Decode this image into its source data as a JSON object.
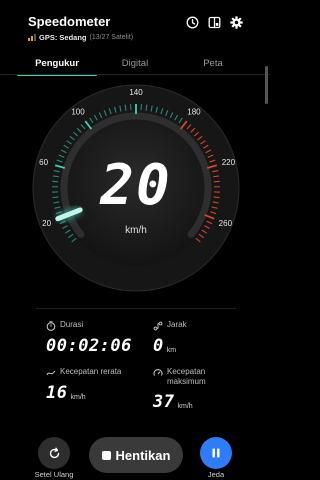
{
  "app": {
    "title": "Speedometer",
    "gps_label": "GPS: Sedang",
    "gps_detail": "(13/27 Satelit)"
  },
  "header_icons": [
    "history-icon",
    "split-screen-icon",
    "settings-gear-icon"
  ],
  "tabs": [
    {
      "label": "Pengukur",
      "active": true
    },
    {
      "label": "Digital",
      "active": false
    },
    {
      "label": "Peta",
      "active": false
    }
  ],
  "gauge": {
    "speed": "20",
    "unit": "km/h",
    "max_speed": 280,
    "tick_labels": [
      "20",
      "60",
      "100",
      "140",
      "180",
      "220",
      "260"
    ],
    "accent_color": "#3fd2b8",
    "warning_color": "#e04a2a"
  },
  "stats": {
    "duration": {
      "label": "Durasi",
      "value": "00:02:06"
    },
    "distance": {
      "label": "Jarak",
      "value": "0",
      "unit": "km"
    },
    "avg_speed": {
      "label": "Kecepatan rerata",
      "value": "16",
      "unit": "km/h"
    },
    "max_speed": {
      "label": "Kecepatan maksimum",
      "value": "37",
      "unit": "km/h"
    }
  },
  "controls": {
    "reset_label": "Setel Ulang",
    "stop_label": "Hentikan",
    "pause_label": "Jeda",
    "pause_color": "#2f7cf6"
  }
}
